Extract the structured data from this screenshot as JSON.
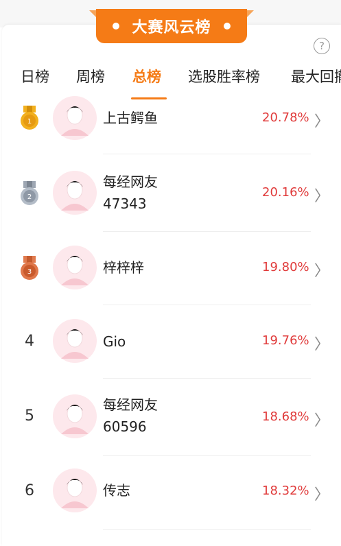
{
  "header": {
    "title": "大赛风云榜",
    "help_icon": "question-circle-icon",
    "help_glyph": "?"
  },
  "colors": {
    "accent": "#f57b16",
    "rise": "#e03a3a",
    "gold": "#f2b01e",
    "silver": "#9ea7b3",
    "bronze": "#d9683f"
  },
  "tabs": [
    {
      "label": "日榜",
      "active": false
    },
    {
      "label": "周榜",
      "active": false
    },
    {
      "label": "总榜",
      "active": true
    },
    {
      "label": "选股胜率榜",
      "active": false
    },
    {
      "label": "最大回撤",
      "active": false
    }
  ],
  "rankings": [
    {
      "rank": "1",
      "medal": "gold",
      "name_line1": "上古鳄鱼",
      "name_line2": "",
      "return": "20.78%"
    },
    {
      "rank": "2",
      "medal": "silver",
      "name_line1": "每经网友",
      "name_line2": "47343",
      "return": "20.16%"
    },
    {
      "rank": "3",
      "medal": "bronze",
      "name_line1": "梓梓梓",
      "name_line2": "",
      "return": "19.80%"
    },
    {
      "rank": "4",
      "medal": "",
      "name_line1": "Gio",
      "name_line2": "",
      "return": "19.76%"
    },
    {
      "rank": "5",
      "medal": "",
      "name_line1": "每经网友",
      "name_line2": "60596",
      "return": "18.68%"
    },
    {
      "rank": "6",
      "medal": "",
      "name_line1": "传志",
      "name_line2": "",
      "return": "18.32%"
    }
  ],
  "chevron": "〉"
}
